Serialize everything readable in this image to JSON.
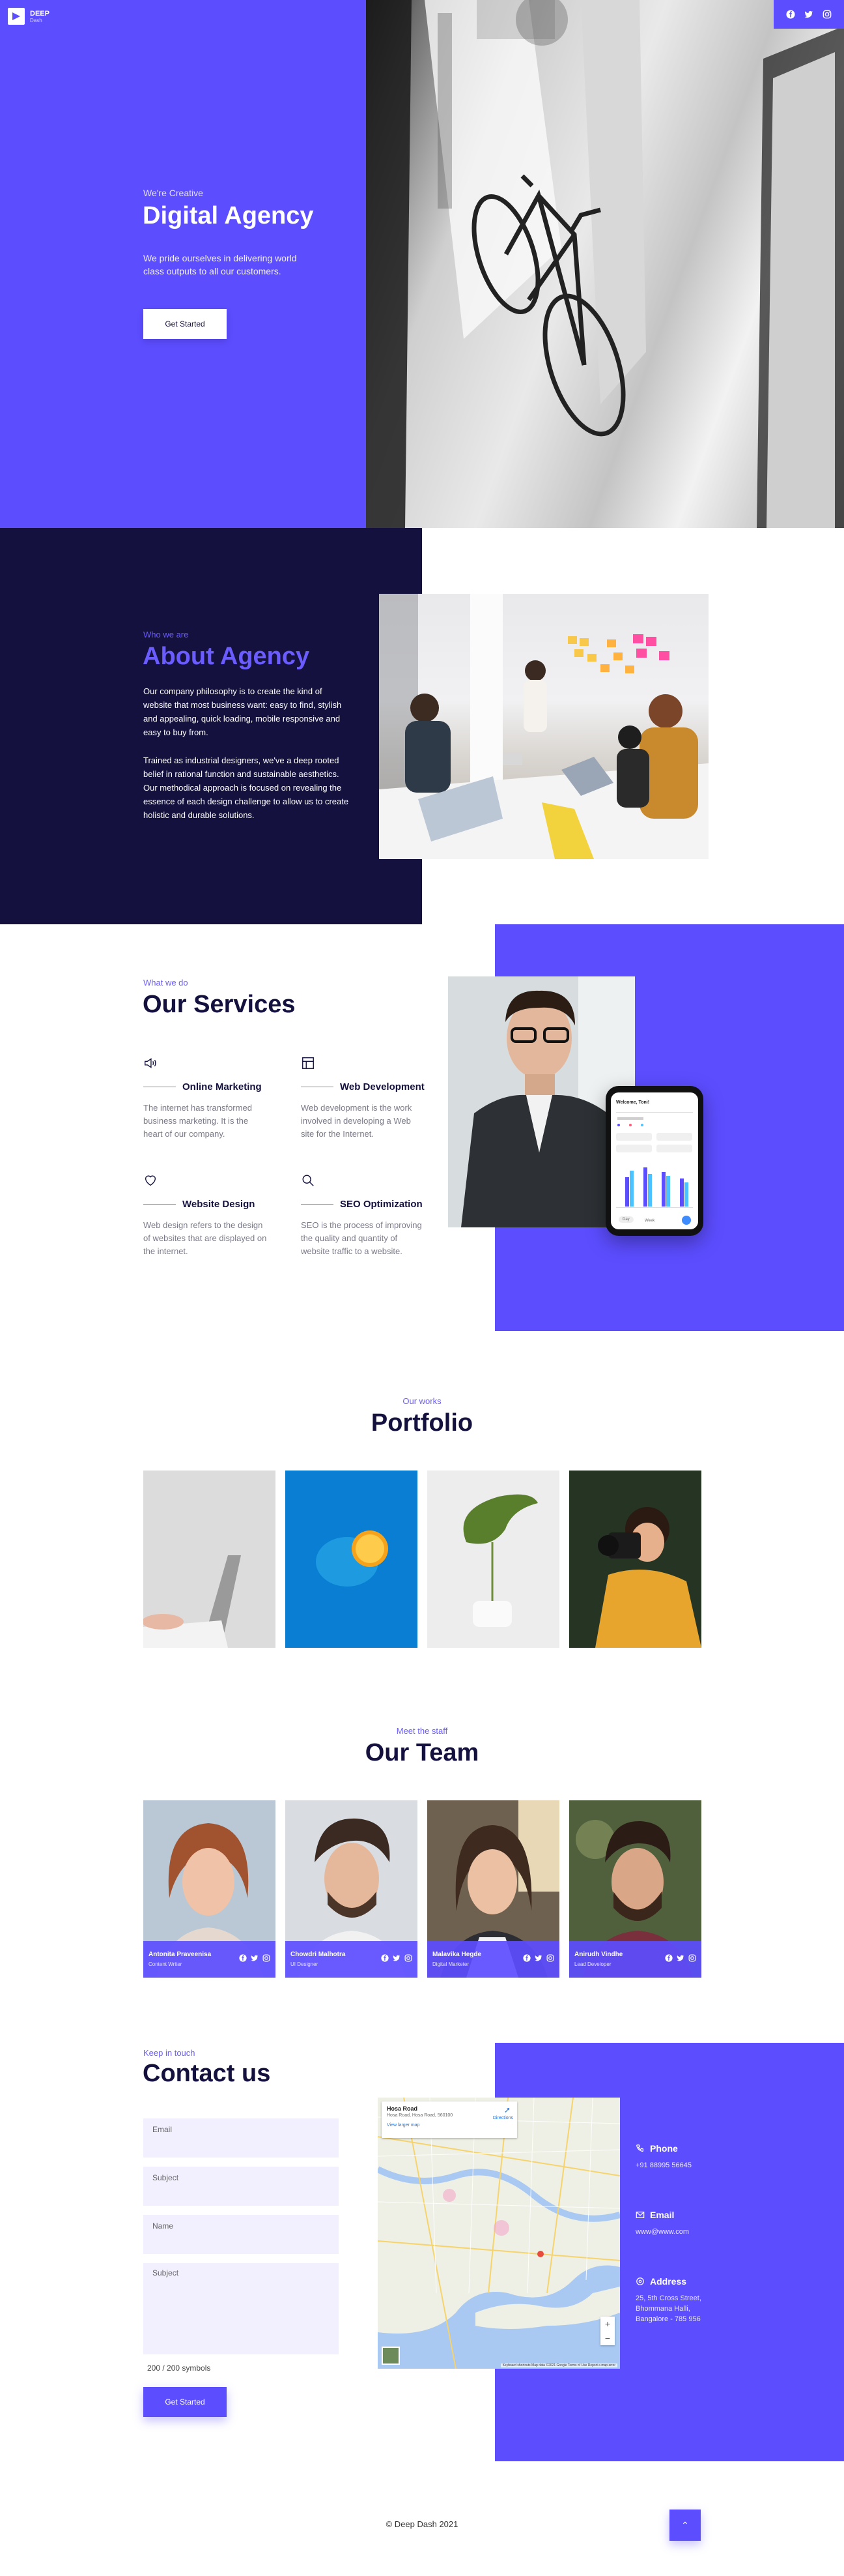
{
  "brand": {
    "name": "DEEP",
    "sub": "Dash"
  },
  "hero": {
    "kicker": "We're Creative",
    "title": "Digital Agency",
    "subtitle": "We pride ourselves in delivering world class outputs to all our customers.",
    "button": "Get Started"
  },
  "social": [
    "facebook-icon",
    "twitter-icon",
    "instagram-icon"
  ],
  "about": {
    "kicker": "Who we are",
    "title": "About Agency",
    "p1": "Our company philosophy is to create the kind of website that most business want: easy to find, stylish and appealing, quick loading, mobile responsive and easy to buy from.",
    "p2": "Trained as industrial designers, we've a deep rooted belief in rational function and sustainable aesthetics. Our methodical approach is focused on revealing the essence of each design challenge to allow us to create holistic and durable solutions."
  },
  "services": {
    "kicker": "What we do",
    "title": "Our Services",
    "items": [
      {
        "name": "Online Marketing",
        "icon": "megaphone-icon",
        "desc": "The internet has transformed business marketing. It is the heart of our company."
      },
      {
        "name": "Web Development",
        "icon": "layout-icon",
        "desc": "Web development is the work involved in developing a Web site for the Internet."
      },
      {
        "name": "Website Design",
        "icon": "heart-icon",
        "desc": "Web design refers to the design of websites that are displayed on the internet."
      },
      {
        "name": "SEO Optimization",
        "icon": "search-icon",
        "desc": "SEO is the process of improving the quality and quantity of website traffic to a website."
      }
    ],
    "phone": {
      "header": "Welcome, Toni!",
      "tabs": [
        "Day",
        "Week"
      ]
    }
  },
  "portfolio": {
    "kicker": "Our works",
    "title": "Portfolio"
  },
  "team": {
    "kicker": "Meet the staff",
    "title": "Our Team",
    "members": [
      {
        "name": "Antonita Praveenisa",
        "role": "Content Writer"
      },
      {
        "name": "Chowdri Malhotra",
        "role": "UI Designer"
      },
      {
        "name": "Malavika Hegde",
        "role": "Digital Marketer"
      },
      {
        "name": "Anirudh Vindhe",
        "role": "Lead Developer"
      }
    ]
  },
  "contact": {
    "kicker": "Keep in touch",
    "title": "Contact us",
    "fields": {
      "email": "Email",
      "subject": "Subject",
      "name": "Name",
      "message": "Subject"
    },
    "counter": "200 / 200 symbols",
    "button": "Get Started",
    "map": {
      "title": "Hosa Road",
      "address": "Hosa Road, Hosa Road, 560100",
      "link": "View larger map",
      "directions": "Directions",
      "zoom_in": "+",
      "zoom_out": "−",
      "footer": "Keyboard shortcuts  Map data ©2021 Google  Terms of Use  Report a map error"
    },
    "info": [
      {
        "label": "Phone",
        "value": "+91 88995 56645",
        "icon": "phone-icon"
      },
      {
        "label": "Email",
        "value": "www@www.com",
        "icon": "mail-icon"
      },
      {
        "label": "Address",
        "value": "25, 5th Cross Street, Bhommana Halli, Bangalore - 785 956",
        "icon": "location-icon"
      }
    ]
  },
  "footer": {
    "copyright": "© Deep Dash 2021",
    "top_button": "⌃"
  },
  "colors": {
    "accent": "#5c4dff",
    "navy": "#14113f",
    "field": "#f2f0ff"
  }
}
